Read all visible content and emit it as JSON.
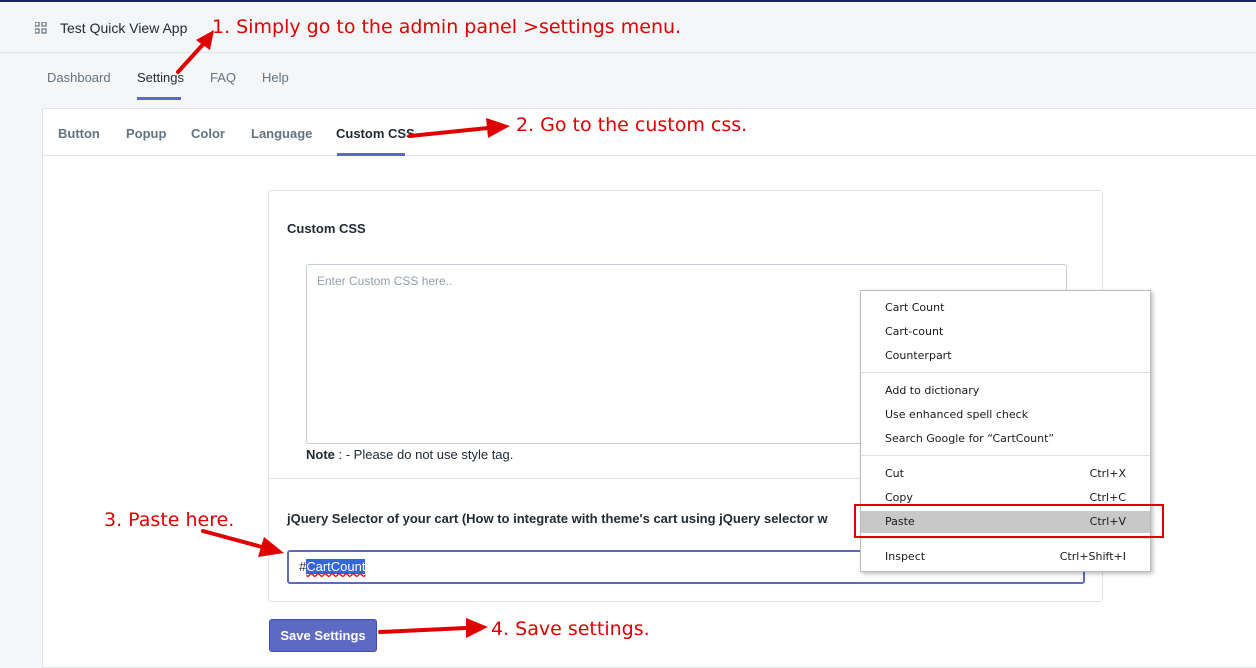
{
  "app": {
    "title": "Test Quick View App"
  },
  "nav": [
    "Dashboard",
    "Settings",
    "FAQ",
    "Help"
  ],
  "tabs": [
    "Button",
    "Popup",
    "Color",
    "Language",
    "Custom CSS"
  ],
  "custom_css": {
    "title": "Custom CSS",
    "placeholder": "Enter Custom CSS here..",
    "note_label": "Note",
    "note_text": " : - Please do not use style tag."
  },
  "selector": {
    "label": "jQuery Selector of your cart (How to integrate with theme's cart using jQuery selector w",
    "prefix": "#",
    "value": "CartCount"
  },
  "save_button": "Save Settings",
  "context_menu": {
    "suggestions": [
      "Cart Count",
      "Cart-count",
      "Counterpart"
    ],
    "spell": [
      "Add to dictionary",
      "Use enhanced spell check",
      "Search Google for “CartCount”"
    ],
    "edit": [
      {
        "label": "Cut",
        "shortcut": "Ctrl+X"
      },
      {
        "label": "Copy",
        "shortcut": "Ctrl+C"
      },
      {
        "label": "Paste",
        "shortcut": "Ctrl+V"
      }
    ],
    "inspect": {
      "label": "Inspect",
      "shortcut": "Ctrl+Shift+I"
    }
  },
  "annotations": [
    "1. Simply go to the admin panel >settings menu.",
    "2. Go to the custom css.",
    "3. Paste here.",
    "4. Save settings."
  ],
  "colors": {
    "accent": "#5c6ac4",
    "annotation": "#e00000",
    "selection": "#3367d6"
  }
}
